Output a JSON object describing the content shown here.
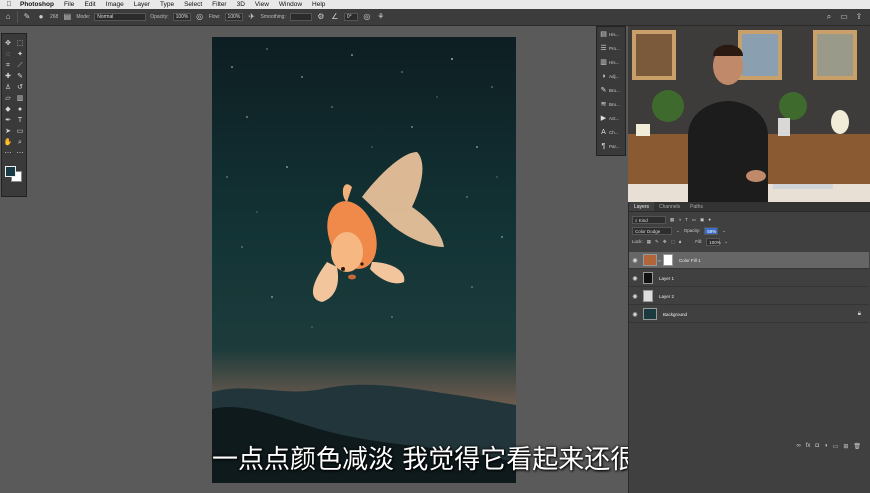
{
  "menubar": {
    "apple": "",
    "app": "Photoshop",
    "items": [
      "File",
      "Edit",
      "Image",
      "Layer",
      "Type",
      "Select",
      "Filter",
      "3D",
      "View",
      "Window",
      "Help"
    ]
  },
  "options": {
    "brush_size": "268",
    "mode_label": "Mode:",
    "mode_value": "Normal",
    "opacity_label": "Opacity:",
    "opacity_value": "100%",
    "flow_label": "Flow:",
    "flow_value": "100%",
    "smoothing_label": "Smoothing:",
    "angle_value": "0°"
  },
  "panel_strip": [
    {
      "icon": "history-icon",
      "label": "His..."
    },
    {
      "icon": "properties-icon",
      "label": "Pro..."
    },
    {
      "icon": "histogram-icon",
      "label": "His..."
    },
    {
      "icon": "adjustments-icon",
      "label": "Adj..."
    },
    {
      "icon": "brushes-icon",
      "label": "Bru..."
    },
    {
      "icon": "brush-settings-icon",
      "label": "Bru..."
    },
    {
      "icon": "actions-icon",
      "label": "Act..."
    },
    {
      "icon": "character-icon",
      "label": "Ch..."
    },
    {
      "icon": "paragraph-icon",
      "label": "Par..."
    }
  ],
  "layers_panel": {
    "tabs": [
      "Layers",
      "Channels",
      "Paths"
    ],
    "active_tab": "Layers",
    "filter_kind": "Kind",
    "blend_mode": "Color Dodge",
    "opacity_label": "Opacity:",
    "opacity_value": "59%",
    "lock_label": "Lock:",
    "fill_label": "Fill:",
    "fill_value": "100%",
    "layers": [
      {
        "name": "Color Fill 1",
        "selected": true,
        "thumb_color": "#b0663a"
      },
      {
        "name": "Layer 1",
        "selected": false,
        "thumb_color": "#111111"
      },
      {
        "name": "Layer 2",
        "selected": false,
        "thumb_color": "#dddddd"
      },
      {
        "name": "Background",
        "selected": false,
        "thumb_color": "#1b3a40"
      }
    ]
  },
  "subtitle": "一点点颜色减淡 我觉得它看起来还很酷",
  "colors": {
    "foreground": "#1a3a45",
    "background": "#ffffff",
    "fill_swatch": "#b0663a"
  }
}
